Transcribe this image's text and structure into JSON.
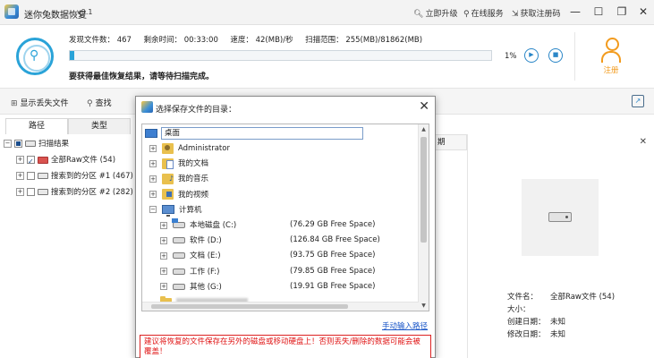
{
  "app": {
    "title": "迷你兔数据恢复",
    "version": "v9.1",
    "links": [
      "立即升级",
      "在线服务",
      "获取注册码"
    ]
  },
  "scan": {
    "found_label": "发现文件数：",
    "found_value": "467",
    "remaining_label": "剩余时间：",
    "remaining_value": "00:33:00",
    "speed_label": "速度：",
    "speed_value": "42(MB)/秒",
    "range_label": "扫描范围：",
    "range_value": "255(MB)/81862(MB)",
    "progress": 0.01,
    "progress_text": "1%",
    "message": "要获得最佳恢复结果，请等待扫描完成。"
  },
  "register_label": "注册",
  "toolbar": {
    "show_lost": "显示丢失文件",
    "search": "查找"
  },
  "left": {
    "tabs": [
      "路径",
      "类型"
    ],
    "tree": [
      {
        "label": "扫描结果",
        "level": 0,
        "expander": "−",
        "check": "partial",
        "icon": "drive"
      },
      {
        "label": "全部Raw文件 (54)",
        "level": 1,
        "expander": "+",
        "check": "checked",
        "icon": "raw"
      },
      {
        "label": "搜索到的分区 #1 (467)",
        "level": 1,
        "expander": "+",
        "check": "none",
        "icon": "drive"
      },
      {
        "label": "搜索到的分区 #2 (282)",
        "level": 1,
        "expander": "+",
        "check": "none",
        "icon": "drive"
      }
    ]
  },
  "list_header_fragment": "期",
  "right": {
    "info": [
      {
        "key": "文件名：",
        "value": "全部Raw文件 (54)"
      },
      {
        "key": "大小：",
        "value": ""
      },
      {
        "key": "创建日期：",
        "value": "未知"
      },
      {
        "key": "修改日期：",
        "value": "未知"
      }
    ]
  },
  "dialog": {
    "title": "选择保存文件的目录：",
    "desktop": "桌面",
    "items": [
      {
        "label": "Administrator",
        "icon": "user",
        "indent": 0,
        "expander": "+"
      },
      {
        "label": "我的文档",
        "icon": "doc",
        "indent": 0,
        "expander": "+"
      },
      {
        "label": "我的音乐",
        "icon": "music",
        "indent": 0,
        "expander": "+"
      },
      {
        "label": "我的视频",
        "icon": "video",
        "indent": 0,
        "expander": "+"
      },
      {
        "label": "计算机",
        "icon": "pc",
        "indent": 0,
        "expander": "−"
      },
      {
        "label": "本地磁盘 (C:)",
        "icon": "sys",
        "indent": 1,
        "expander": "+",
        "space": "(76.29 GB Free Space)"
      },
      {
        "label": "软件 (D:)",
        "icon": "hd",
        "indent": 1,
        "expander": "+",
        "space": "(126.84 GB Free Space)"
      },
      {
        "label": "文档 (E:)",
        "icon": "hd",
        "indent": 1,
        "expander": "+",
        "space": "(93.75 GB Free Space)"
      },
      {
        "label": "工作 (F:)",
        "icon": "hd",
        "indent": 1,
        "expander": "+",
        "space": "(79.85 GB Free Space)"
      },
      {
        "label": "其他 (G:)",
        "icon": "hd",
        "indent": 1,
        "expander": "+",
        "space": "(19.91 GB Free Space)"
      }
    ],
    "manual_link": "手动输入路径",
    "warning": "建议将恢复的文件保存在另外的磁盘或移动硬盘上！否则丢失/删除的数据可能会被覆盖！"
  }
}
